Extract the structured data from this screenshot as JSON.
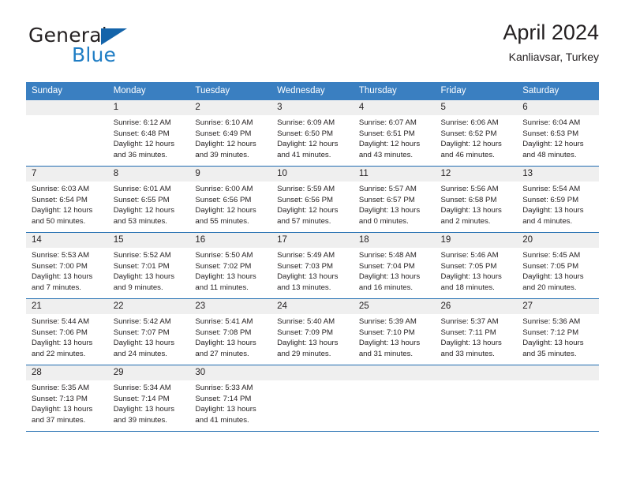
{
  "brand": {
    "name_top": "General",
    "name_bottom": "Blue",
    "logo_icon": "blue-triangle-logo",
    "accent_color": "#1464aa",
    "blue_text_color": "#1f7dc4"
  },
  "header": {
    "month_title": "April 2024",
    "location": "Kanliavsar, Turkey"
  },
  "theme": {
    "header_row_bg": "#3a7fc1",
    "row_separator": "#1f6cb0",
    "daynum_bg": "#efefef"
  },
  "weekdays": [
    "Sunday",
    "Monday",
    "Tuesday",
    "Wednesday",
    "Thursday",
    "Friday",
    "Saturday"
  ],
  "weeks": [
    [
      {
        "day": "",
        "sunrise": "",
        "sunset": "",
        "daylight_line1": "",
        "daylight_line2": "",
        "empty": true
      },
      {
        "day": "1",
        "sunrise": "Sunrise: 6:12 AM",
        "sunset": "Sunset: 6:48 PM",
        "daylight_line1": "Daylight: 12 hours",
        "daylight_line2": "and 36 minutes."
      },
      {
        "day": "2",
        "sunrise": "Sunrise: 6:10 AM",
        "sunset": "Sunset: 6:49 PM",
        "daylight_line1": "Daylight: 12 hours",
        "daylight_line2": "and 39 minutes."
      },
      {
        "day": "3",
        "sunrise": "Sunrise: 6:09 AM",
        "sunset": "Sunset: 6:50 PM",
        "daylight_line1": "Daylight: 12 hours",
        "daylight_line2": "and 41 minutes."
      },
      {
        "day": "4",
        "sunrise": "Sunrise: 6:07 AM",
        "sunset": "Sunset: 6:51 PM",
        "daylight_line1": "Daylight: 12 hours",
        "daylight_line2": "and 43 minutes."
      },
      {
        "day": "5",
        "sunrise": "Sunrise: 6:06 AM",
        "sunset": "Sunset: 6:52 PM",
        "daylight_line1": "Daylight: 12 hours",
        "daylight_line2": "and 46 minutes."
      },
      {
        "day": "6",
        "sunrise": "Sunrise: 6:04 AM",
        "sunset": "Sunset: 6:53 PM",
        "daylight_line1": "Daylight: 12 hours",
        "daylight_line2": "and 48 minutes."
      }
    ],
    [
      {
        "day": "7",
        "sunrise": "Sunrise: 6:03 AM",
        "sunset": "Sunset: 6:54 PM",
        "daylight_line1": "Daylight: 12 hours",
        "daylight_line2": "and 50 minutes."
      },
      {
        "day": "8",
        "sunrise": "Sunrise: 6:01 AM",
        "sunset": "Sunset: 6:55 PM",
        "daylight_line1": "Daylight: 12 hours",
        "daylight_line2": "and 53 minutes."
      },
      {
        "day": "9",
        "sunrise": "Sunrise: 6:00 AM",
        "sunset": "Sunset: 6:56 PM",
        "daylight_line1": "Daylight: 12 hours",
        "daylight_line2": "and 55 minutes."
      },
      {
        "day": "10",
        "sunrise": "Sunrise: 5:59 AM",
        "sunset": "Sunset: 6:56 PM",
        "daylight_line1": "Daylight: 12 hours",
        "daylight_line2": "and 57 minutes."
      },
      {
        "day": "11",
        "sunrise": "Sunrise: 5:57 AM",
        "sunset": "Sunset: 6:57 PM",
        "daylight_line1": "Daylight: 13 hours",
        "daylight_line2": "and 0 minutes."
      },
      {
        "day": "12",
        "sunrise": "Sunrise: 5:56 AM",
        "sunset": "Sunset: 6:58 PM",
        "daylight_line1": "Daylight: 13 hours",
        "daylight_line2": "and 2 minutes."
      },
      {
        "day": "13",
        "sunrise": "Sunrise: 5:54 AM",
        "sunset": "Sunset: 6:59 PM",
        "daylight_line1": "Daylight: 13 hours",
        "daylight_line2": "and 4 minutes."
      }
    ],
    [
      {
        "day": "14",
        "sunrise": "Sunrise: 5:53 AM",
        "sunset": "Sunset: 7:00 PM",
        "daylight_line1": "Daylight: 13 hours",
        "daylight_line2": "and 7 minutes."
      },
      {
        "day": "15",
        "sunrise": "Sunrise: 5:52 AM",
        "sunset": "Sunset: 7:01 PM",
        "daylight_line1": "Daylight: 13 hours",
        "daylight_line2": "and 9 minutes."
      },
      {
        "day": "16",
        "sunrise": "Sunrise: 5:50 AM",
        "sunset": "Sunset: 7:02 PM",
        "daylight_line1": "Daylight: 13 hours",
        "daylight_line2": "and 11 minutes."
      },
      {
        "day": "17",
        "sunrise": "Sunrise: 5:49 AM",
        "sunset": "Sunset: 7:03 PM",
        "daylight_line1": "Daylight: 13 hours",
        "daylight_line2": "and 13 minutes."
      },
      {
        "day": "18",
        "sunrise": "Sunrise: 5:48 AM",
        "sunset": "Sunset: 7:04 PM",
        "daylight_line1": "Daylight: 13 hours",
        "daylight_line2": "and 16 minutes."
      },
      {
        "day": "19",
        "sunrise": "Sunrise: 5:46 AM",
        "sunset": "Sunset: 7:05 PM",
        "daylight_line1": "Daylight: 13 hours",
        "daylight_line2": "and 18 minutes."
      },
      {
        "day": "20",
        "sunrise": "Sunrise: 5:45 AM",
        "sunset": "Sunset: 7:05 PM",
        "daylight_line1": "Daylight: 13 hours",
        "daylight_line2": "and 20 minutes."
      }
    ],
    [
      {
        "day": "21",
        "sunrise": "Sunrise: 5:44 AM",
        "sunset": "Sunset: 7:06 PM",
        "daylight_line1": "Daylight: 13 hours",
        "daylight_line2": "and 22 minutes."
      },
      {
        "day": "22",
        "sunrise": "Sunrise: 5:42 AM",
        "sunset": "Sunset: 7:07 PM",
        "daylight_line1": "Daylight: 13 hours",
        "daylight_line2": "and 24 minutes."
      },
      {
        "day": "23",
        "sunrise": "Sunrise: 5:41 AM",
        "sunset": "Sunset: 7:08 PM",
        "daylight_line1": "Daylight: 13 hours",
        "daylight_line2": "and 27 minutes."
      },
      {
        "day": "24",
        "sunrise": "Sunrise: 5:40 AM",
        "sunset": "Sunset: 7:09 PM",
        "daylight_line1": "Daylight: 13 hours",
        "daylight_line2": "and 29 minutes."
      },
      {
        "day": "25",
        "sunrise": "Sunrise: 5:39 AM",
        "sunset": "Sunset: 7:10 PM",
        "daylight_line1": "Daylight: 13 hours",
        "daylight_line2": "and 31 minutes."
      },
      {
        "day": "26",
        "sunrise": "Sunrise: 5:37 AM",
        "sunset": "Sunset: 7:11 PM",
        "daylight_line1": "Daylight: 13 hours",
        "daylight_line2": "and 33 minutes."
      },
      {
        "day": "27",
        "sunrise": "Sunrise: 5:36 AM",
        "sunset": "Sunset: 7:12 PM",
        "daylight_line1": "Daylight: 13 hours",
        "daylight_line2": "and 35 minutes."
      }
    ],
    [
      {
        "day": "28",
        "sunrise": "Sunrise: 5:35 AM",
        "sunset": "Sunset: 7:13 PM",
        "daylight_line1": "Daylight: 13 hours",
        "daylight_line2": "and 37 minutes."
      },
      {
        "day": "29",
        "sunrise": "Sunrise: 5:34 AM",
        "sunset": "Sunset: 7:14 PM",
        "daylight_line1": "Daylight: 13 hours",
        "daylight_line2": "and 39 minutes."
      },
      {
        "day": "30",
        "sunrise": "Sunrise: 5:33 AM",
        "sunset": "Sunset: 7:14 PM",
        "daylight_line1": "Daylight: 13 hours",
        "daylight_line2": "and 41 minutes."
      },
      {
        "day": "",
        "sunrise": "",
        "sunset": "",
        "daylight_line1": "",
        "daylight_line2": "",
        "empty": true
      },
      {
        "day": "",
        "sunrise": "",
        "sunset": "",
        "daylight_line1": "",
        "daylight_line2": "",
        "empty": true
      },
      {
        "day": "",
        "sunrise": "",
        "sunset": "",
        "daylight_line1": "",
        "daylight_line2": "",
        "empty": true
      },
      {
        "day": "",
        "sunrise": "",
        "sunset": "",
        "daylight_line1": "",
        "daylight_line2": "",
        "empty": true
      }
    ]
  ]
}
